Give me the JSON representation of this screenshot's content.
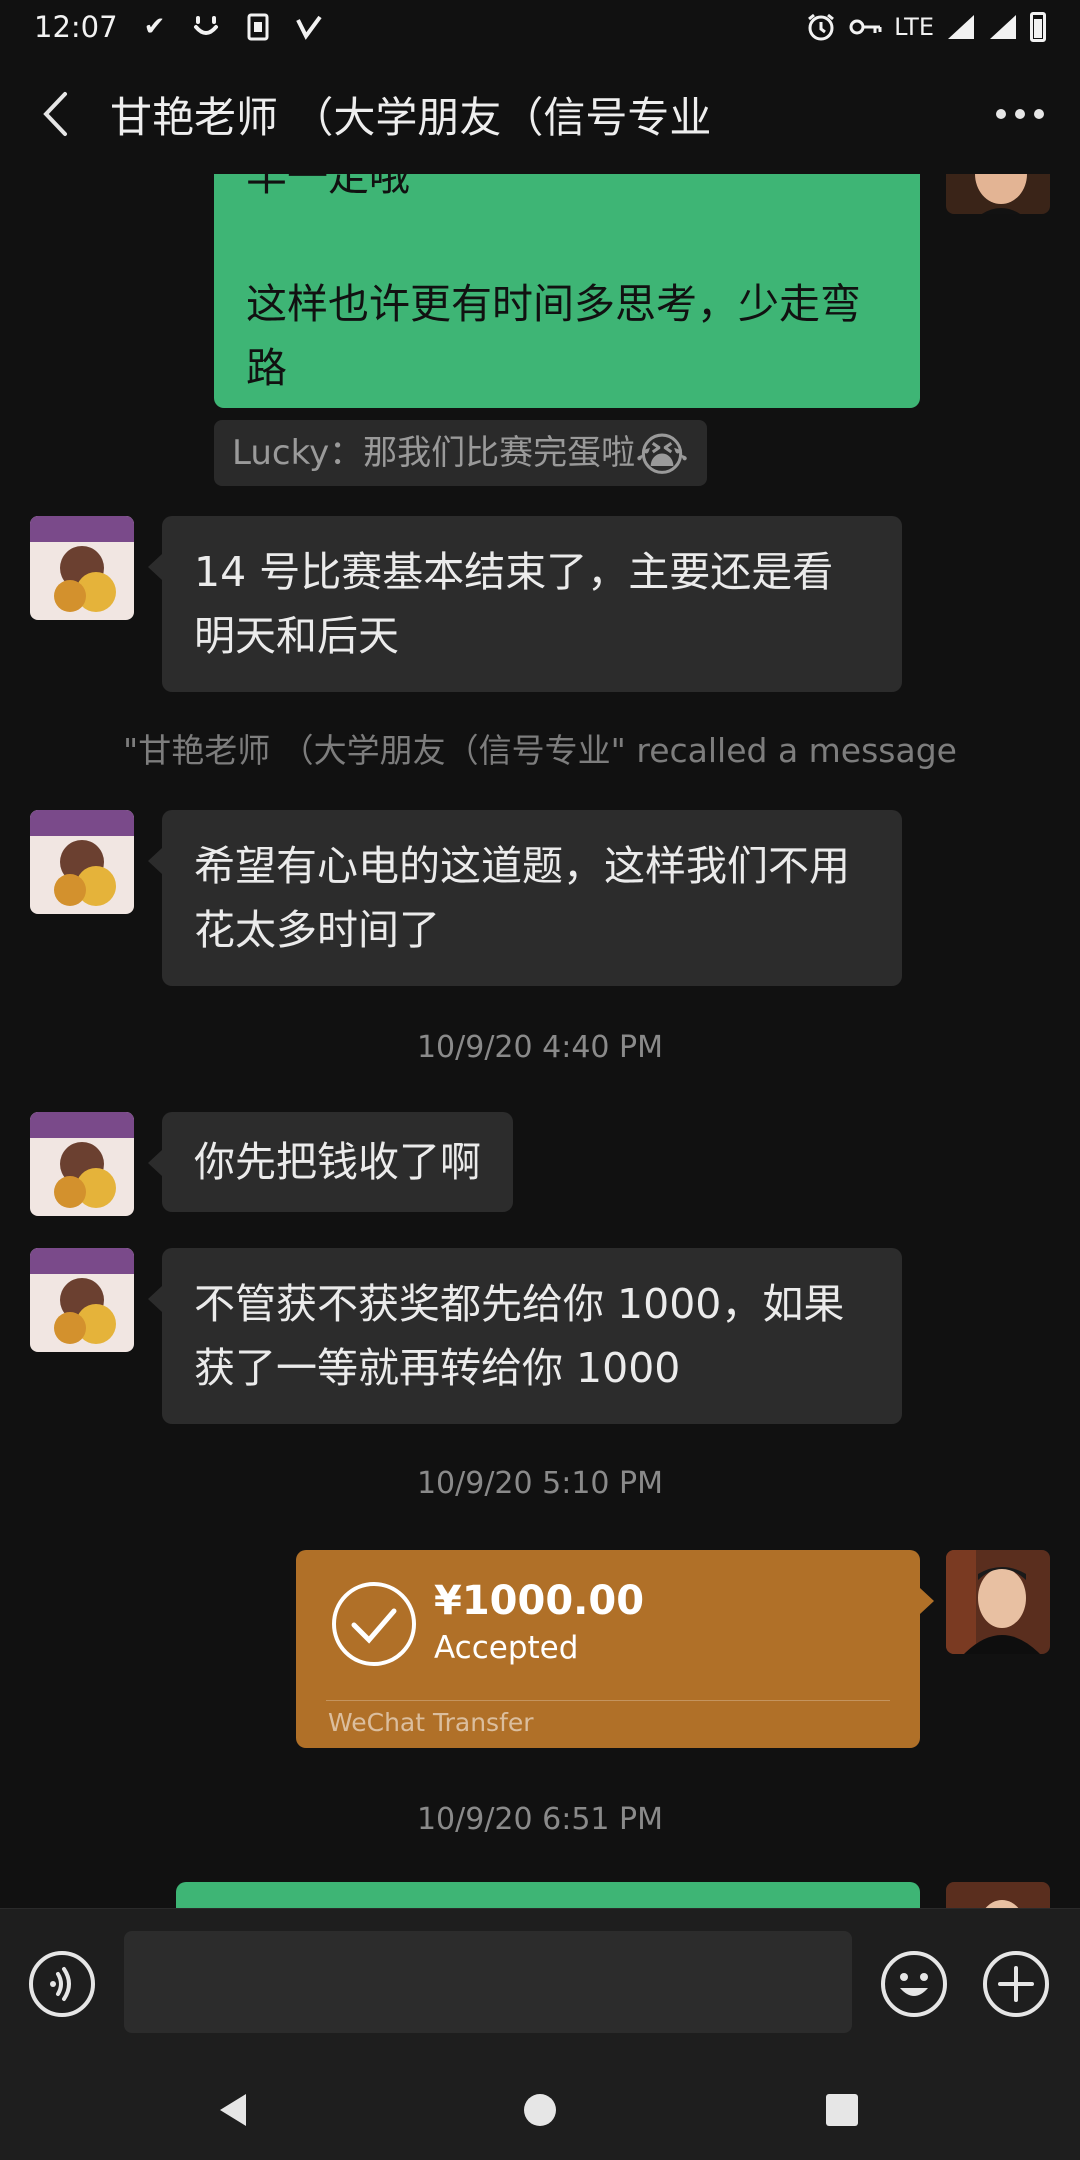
{
  "status_bar": {
    "time": "12:07",
    "network": "LTE",
    "icons": [
      "check-mark-icon",
      "smile-icon",
      "sim-card-icon",
      "check-alt-icon",
      "alarm-icon",
      "vpn-key-icon",
      "signal-icon",
      "battery-icon"
    ]
  },
  "header": {
    "title": "甘艳老师 （大学朋友（信号专业",
    "back_icon": "back-arrow-icon",
    "more_icon": "more-dots-icon"
  },
  "messages": {
    "partial_top_line": "丰一定哦",
    "self_bubble_text": "这样也许更有时间多思考，少走弯路",
    "quote_text": "Lucky：那我们比赛完蛋啦",
    "quote_emoji": "😭",
    "msg1": "14 号比赛基本结束了，主要还是看明天和后天",
    "recall_notice": "\"甘艳老师 （大学朋友（信号专业\" recalled a message",
    "msg2": "希望有心电的这道题，这样我们不用花太多时间了",
    "timestamp1": "10/9/20 4:40 PM",
    "msg3": "你先把钱收了啊",
    "msg4": "不管获不获奖都先给你 1000，如果获了一等就再转给你 1000",
    "timestamp2": "10/9/20 5:10 PM",
    "transfer": {
      "amount": "¥1000.00",
      "status": "Accepted",
      "footer": "WeChat Transfer"
    },
    "timestamp3": "10/9/20 6:51 PM"
  },
  "input_bar": {
    "voice_icon": "voice-icon",
    "emoji_icon": "emoji-icon",
    "plus_icon": "plus-icon"
  },
  "colors": {
    "background": "#111111",
    "bubble_other": "#2c2c2c",
    "bubble_self": "#3eb575",
    "transfer": "#b07028",
    "text": "#e6e6e6"
  }
}
